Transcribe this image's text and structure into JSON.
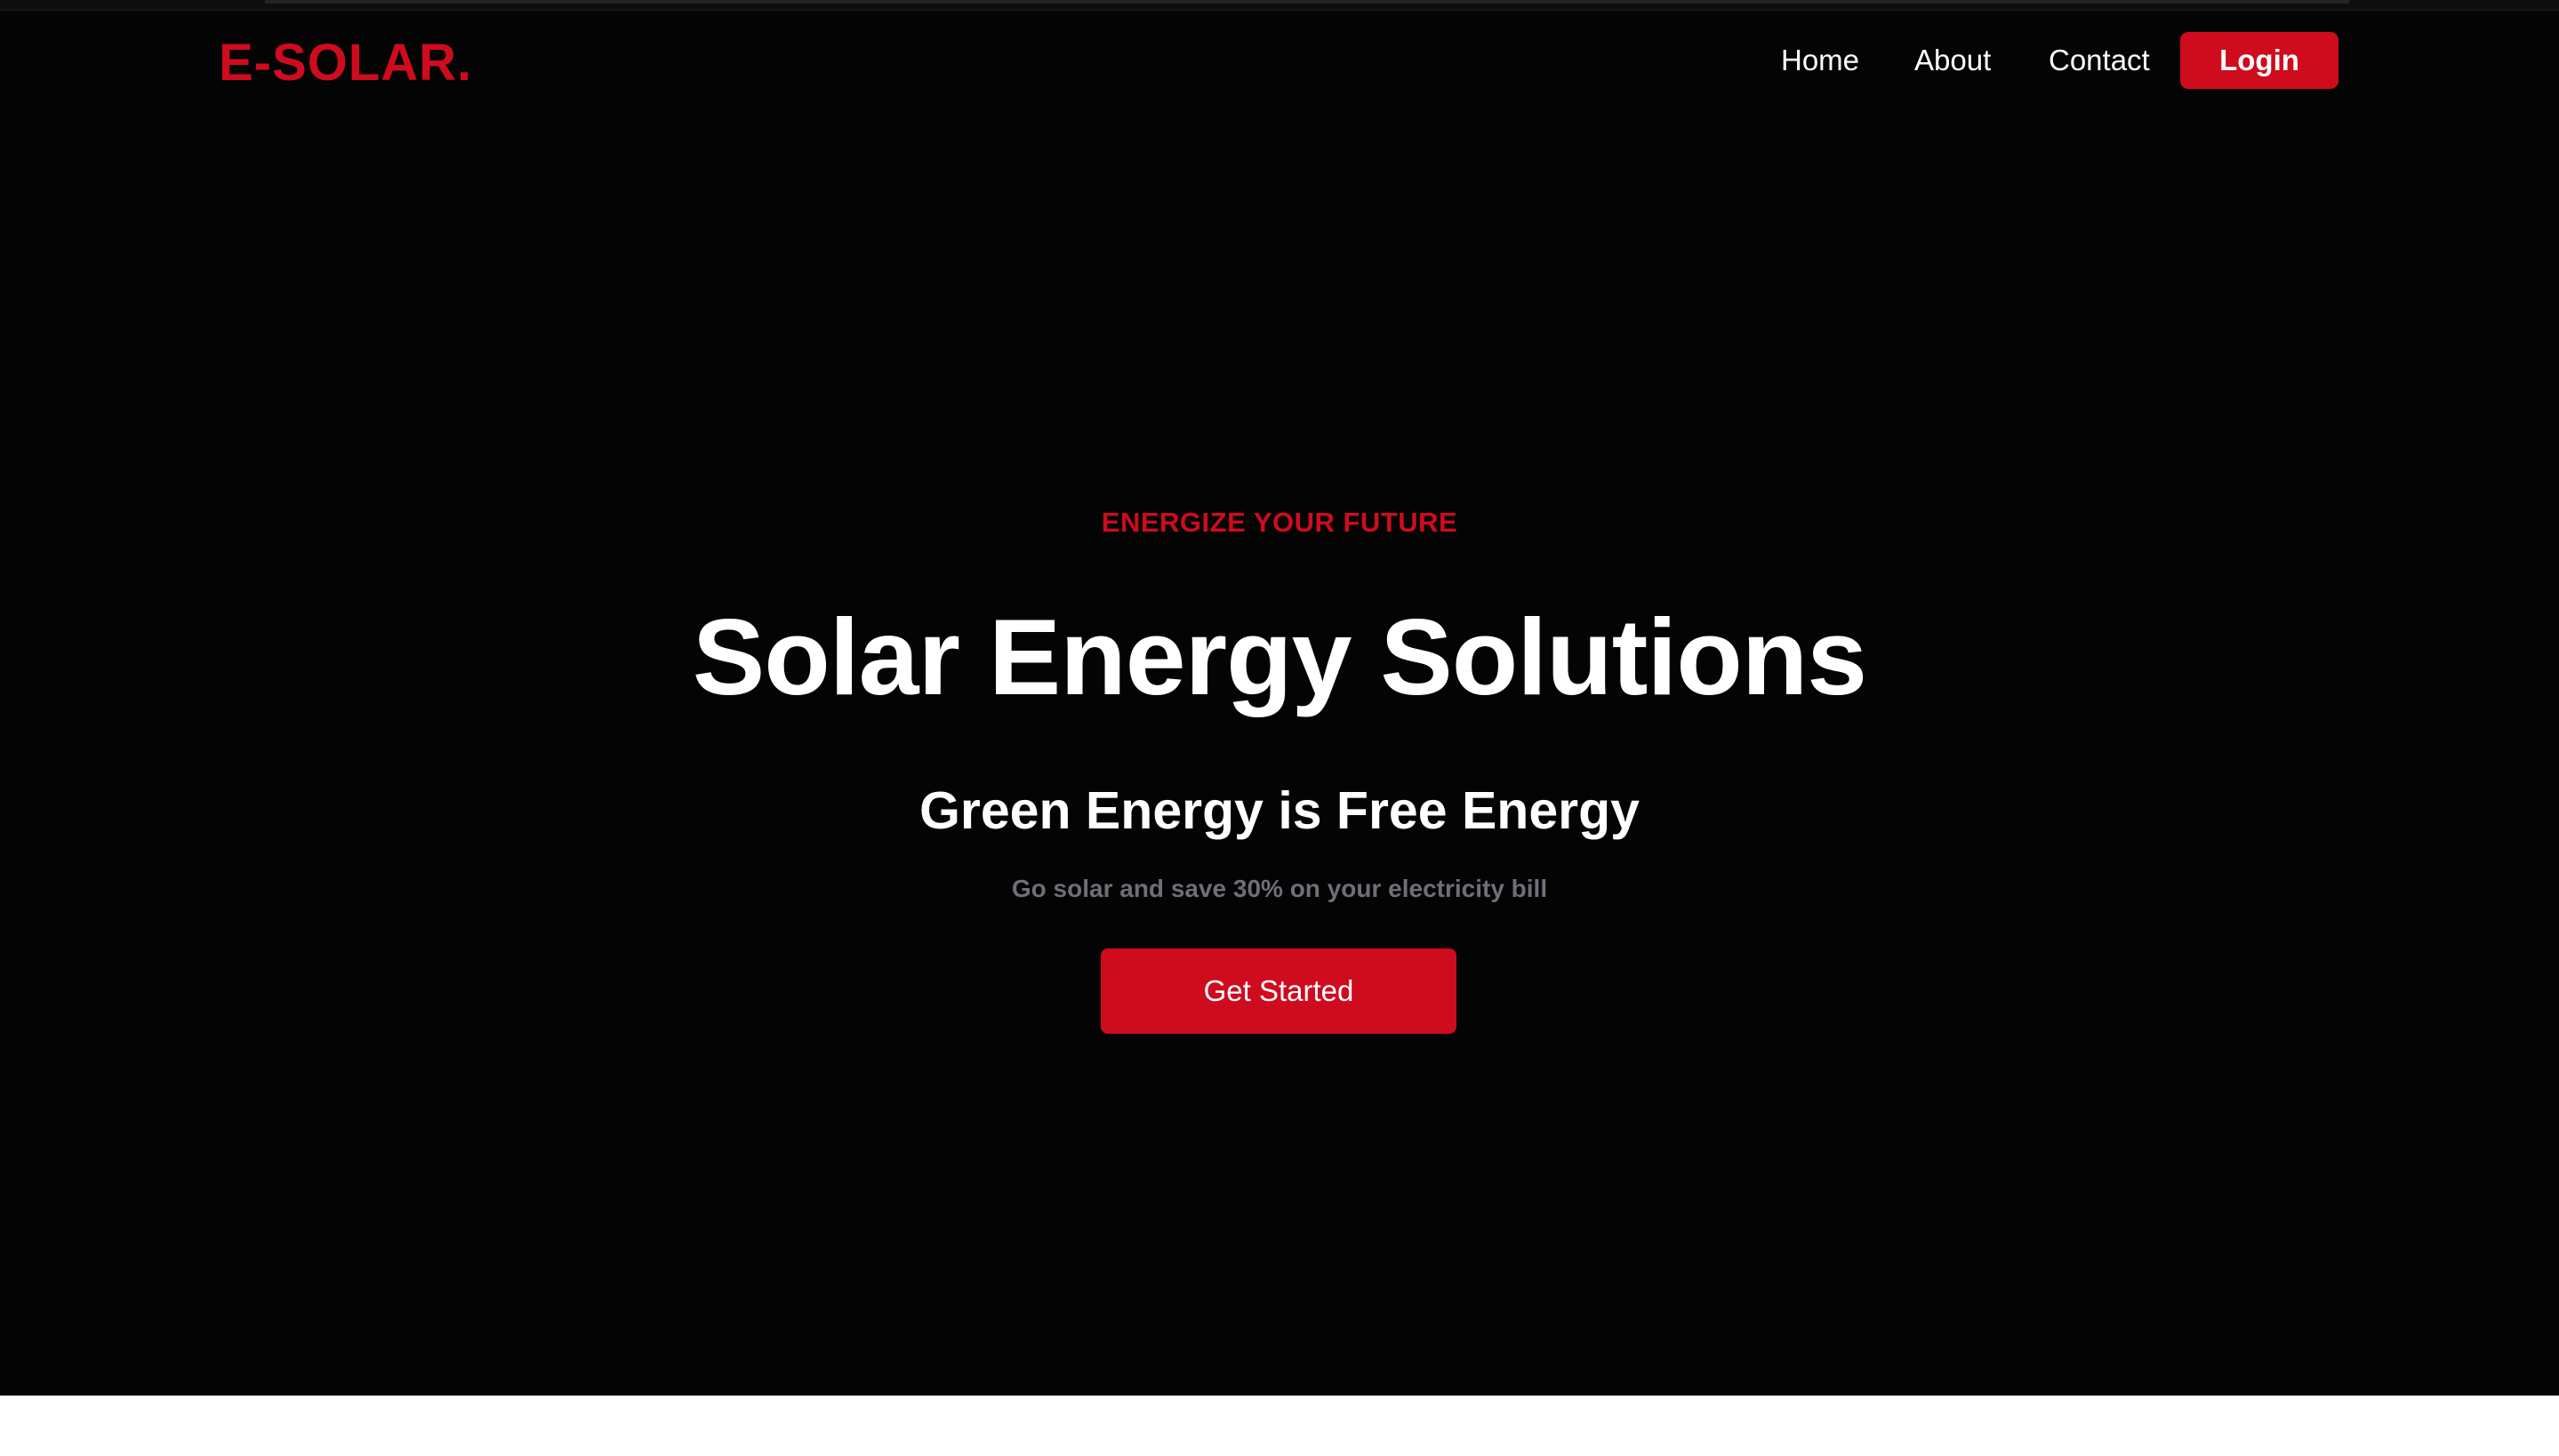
{
  "brand": {
    "logo_text": "E-SOLAR.",
    "accent_color": "#cf0b1e"
  },
  "nav": {
    "links": [
      {
        "label": "Home"
      },
      {
        "label": "About"
      },
      {
        "label": "Contact"
      }
    ],
    "login_label": "Login"
  },
  "hero": {
    "eyebrow": "ENERGIZE YOUR FUTURE",
    "title": "Solar Energy Solutions",
    "subtitle": "Green Energy is Free Energy",
    "tagline": "Go solar and save 30% on your electricity bill",
    "cta_label": "Get Started",
    "background_color": "#030403"
  }
}
